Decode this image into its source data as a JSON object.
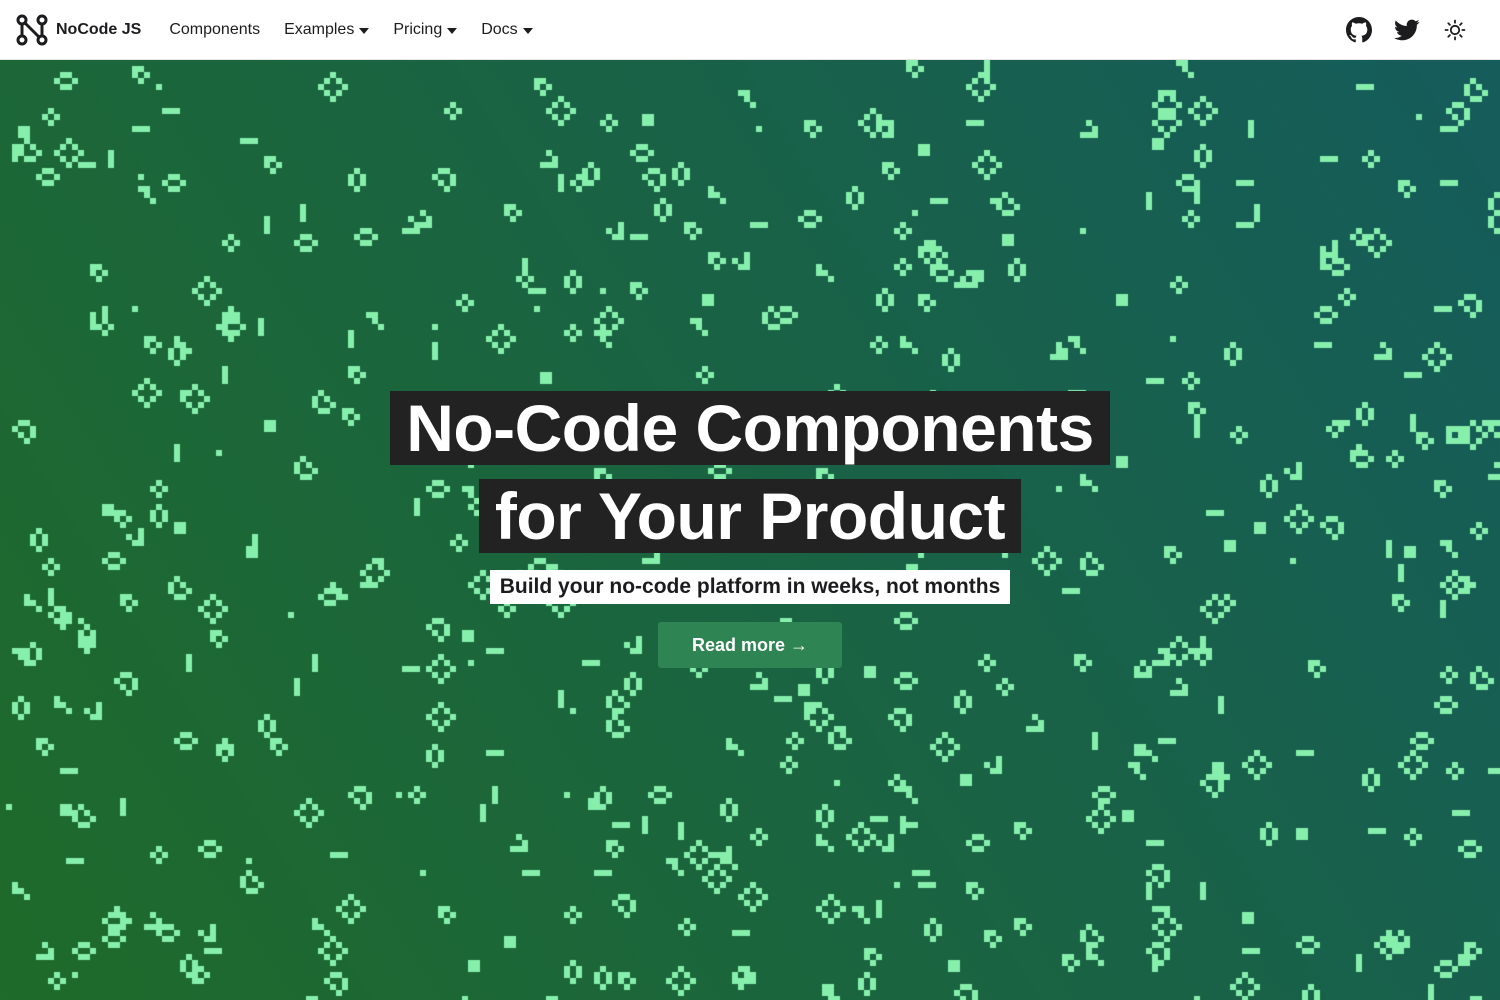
{
  "colors": {
    "gradient_start": "#1f6b2a",
    "gradient_end": "#155c5c",
    "cell": "#86efac",
    "headline_bg": "#222222",
    "button_bg": "#2e8452"
  },
  "navbar": {
    "brand": {
      "icon": "nocode-logo-icon",
      "name": "NoCode JS"
    },
    "links": [
      {
        "label": "Components",
        "has_dropdown": false
      },
      {
        "label": "Examples",
        "has_dropdown": true
      },
      {
        "label": "Pricing",
        "has_dropdown": true
      },
      {
        "label": "Docs",
        "has_dropdown": true
      }
    ],
    "icons": [
      "github-icon",
      "twitter-icon",
      "theme-toggle-sun-icon"
    ]
  },
  "hero": {
    "title_line1": "No-Code Components",
    "title_line2": "for Your Product",
    "subtitle": "Build your no-code platform in weeks, not months",
    "cta_label": "Read more →",
    "background_pattern": "game-of-life cells"
  }
}
